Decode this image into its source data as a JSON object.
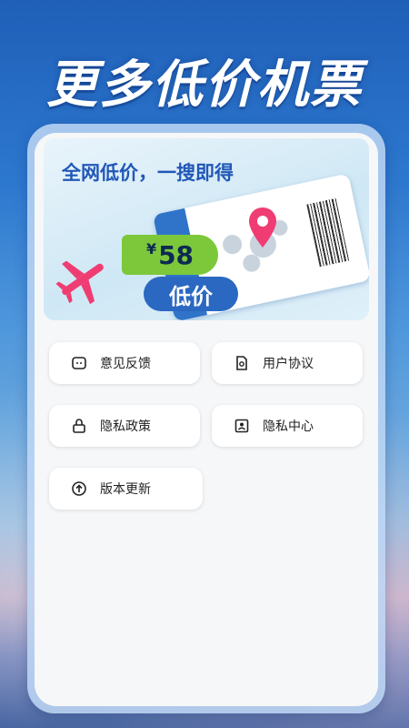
{
  "headline": "更多低价机票",
  "banner": {
    "title": "全网低价，一搜即得",
    "price": "58",
    "currency": "¥",
    "pill": "低价"
  },
  "menu": [
    {
      "label": "意见反馈",
      "icon": "feedback-icon"
    },
    {
      "label": "用户协议",
      "icon": "document-icon"
    },
    {
      "label": "隐私政策",
      "icon": "lock-icon"
    },
    {
      "label": "隐私中心",
      "icon": "user-card-icon"
    },
    {
      "label": "版本更新",
      "icon": "upload-icon"
    }
  ],
  "colors": {
    "accent": "#2158b7",
    "price": "#7cc83a",
    "plane": "#ef3d73"
  }
}
